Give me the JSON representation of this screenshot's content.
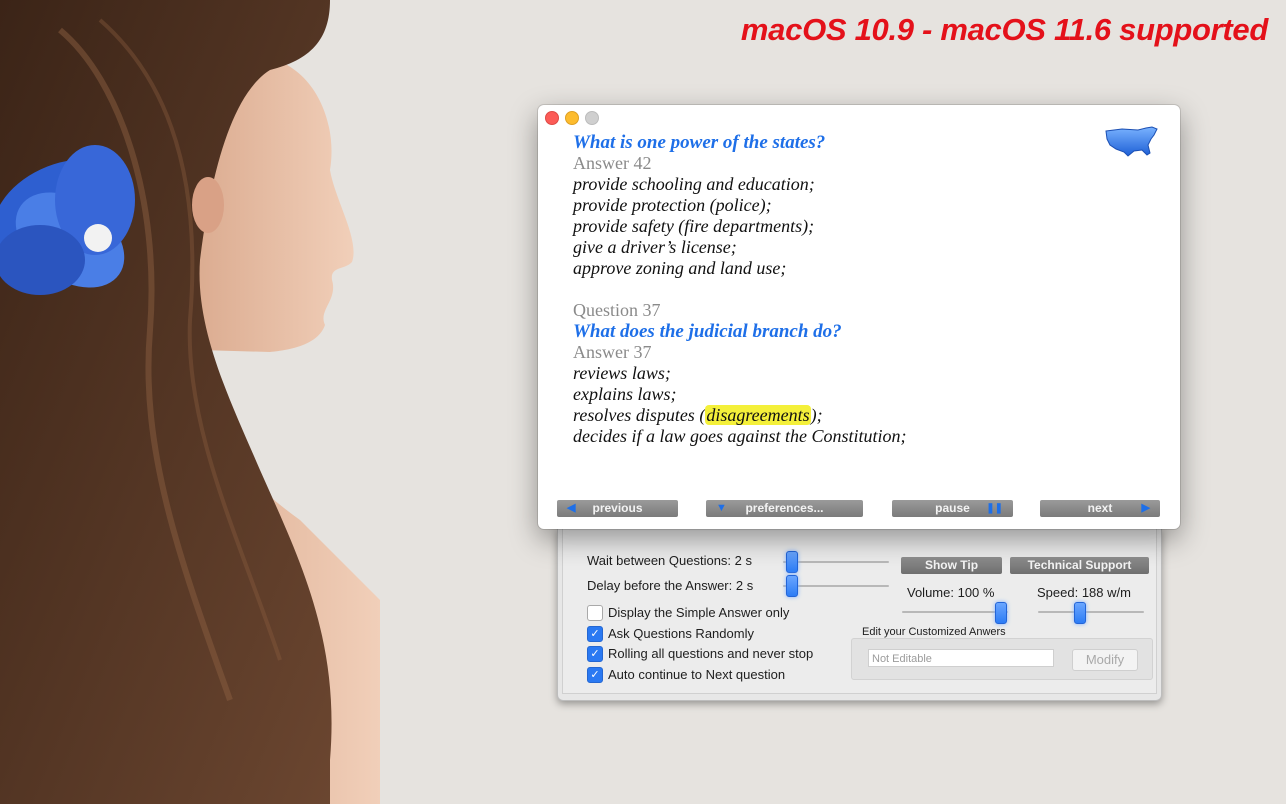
{
  "banner": "macOS 10.9 - macOS 11.6 supported",
  "window": {
    "lines": [
      {
        "kind": "question",
        "text": "What is one power of the states?"
      },
      {
        "kind": "number",
        "text": "Answer 42"
      },
      {
        "kind": "answer",
        "text": "provide schooling and education;"
      },
      {
        "kind": "answer",
        "text": "provide protection (police);"
      },
      {
        "kind": "answer",
        "text": "provide safety (fire departments);"
      },
      {
        "kind": "answer",
        "text": "give a driver’s license;"
      },
      {
        "kind": "answer",
        "text": "approve zoning and land use;"
      },
      {
        "kind": "blank",
        "text": ""
      },
      {
        "kind": "number",
        "text": "Question 37"
      },
      {
        "kind": "question",
        "text": "What does the judicial branch do?"
      },
      {
        "kind": "number",
        "text": "Answer 37"
      },
      {
        "kind": "answer",
        "text": "reviews laws;"
      },
      {
        "kind": "answer",
        "text": "explains laws;"
      }
    ],
    "highlight_line": {
      "before": "resolves disputes (",
      "highlight": "disagreements",
      "after": ");"
    },
    "last_line": "decides if a law goes against the Constitution;",
    "buttons": {
      "previous": "previous",
      "preferences": "preferences...",
      "pause": "pause",
      "next": "next"
    }
  },
  "prefs": {
    "wait_label": "Wait between Questions: 2 s",
    "delay_label": "Delay before the Answer: 2 s",
    "show_tip": "Show Tip",
    "tech_support": "Technical Support",
    "volume_label": "Volume: 100 %",
    "speed_label": "Speed: 188 w/m",
    "volume_level": 1.0,
    "checkboxes": [
      {
        "label": "Display the Simple Answer only",
        "checked": false
      },
      {
        "label": "Ask Questions Randomly",
        "checked": true
      },
      {
        "label": "Rolling all questions and never stop",
        "checked": true
      },
      {
        "label": "Auto continue to Next question",
        "checked": true
      }
    ],
    "edit_heading": "Edit your Customized Anwers",
    "field_placeholder": "Not Editable",
    "modify_label": "Modify"
  },
  "colors": {
    "accent": "#1e6fe8",
    "banner": "#e4111a",
    "highlight": "#f4f03a"
  }
}
